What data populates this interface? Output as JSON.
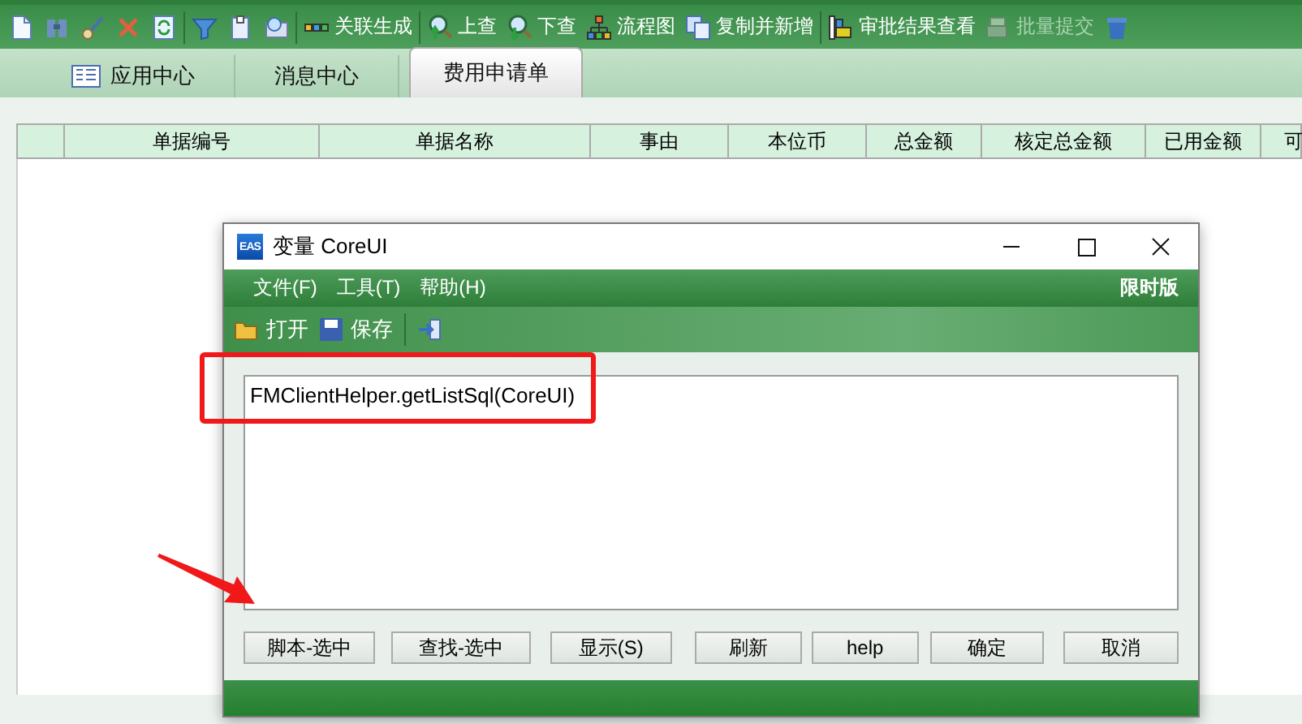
{
  "toolbar": {
    "items": [
      {
        "kind": "icon",
        "disabled": false
      },
      {
        "kind": "icon",
        "disabled": false
      },
      {
        "kind": "icon",
        "disabled": false
      },
      {
        "kind": "icon",
        "disabled": false
      },
      {
        "kind": "icon",
        "disabled": false
      },
      {
        "kind": "separator"
      },
      {
        "kind": "icon",
        "disabled": false
      },
      {
        "kind": "icon",
        "disabled": false
      },
      {
        "kind": "icon",
        "disabled": false
      },
      {
        "kind": "separator"
      },
      {
        "kind": "button",
        "label": "关联生成",
        "disabled": false
      },
      {
        "kind": "separator"
      },
      {
        "kind": "button",
        "label": "上查",
        "disabled": false
      },
      {
        "kind": "button",
        "label": "下查",
        "disabled": false
      },
      {
        "kind": "button",
        "label": "流程图",
        "disabled": false
      },
      {
        "kind": "button",
        "label": "复制并新增",
        "disabled": false
      },
      {
        "kind": "separator"
      },
      {
        "kind": "button",
        "label": "审批结果查看",
        "disabled": false
      },
      {
        "kind": "button",
        "label": "批量提交",
        "disabled": true
      },
      {
        "kind": "icon",
        "disabled": false
      }
    ]
  },
  "tabs": [
    {
      "label": "应用中心",
      "selected": false
    },
    {
      "label": "消息中心",
      "selected": false
    },
    {
      "label": "费用申请单",
      "selected": true
    }
  ],
  "table": {
    "columns": [
      "单据编号",
      "单据名称",
      "事由",
      "本位币",
      "总金额",
      "核定总金额",
      "已用金额",
      "可"
    ]
  },
  "dialog": {
    "logo": "EAS",
    "title": "变量 CoreUI",
    "menu": [
      "文件(F)",
      "工具(T)",
      "帮助(H)"
    ],
    "edition": "限时版",
    "toolbar": [
      {
        "kind": "open",
        "label": "打开"
      },
      {
        "kind": "save",
        "label": "保存"
      },
      {
        "kind": "export"
      }
    ],
    "editor": {
      "value": "FMClientHelper.getListSql(CoreUI)"
    },
    "buttons": [
      "脚本-选中",
      "查找-选中",
      "显示(S)",
      "刷新",
      "help",
      "确定",
      "取消"
    ]
  }
}
